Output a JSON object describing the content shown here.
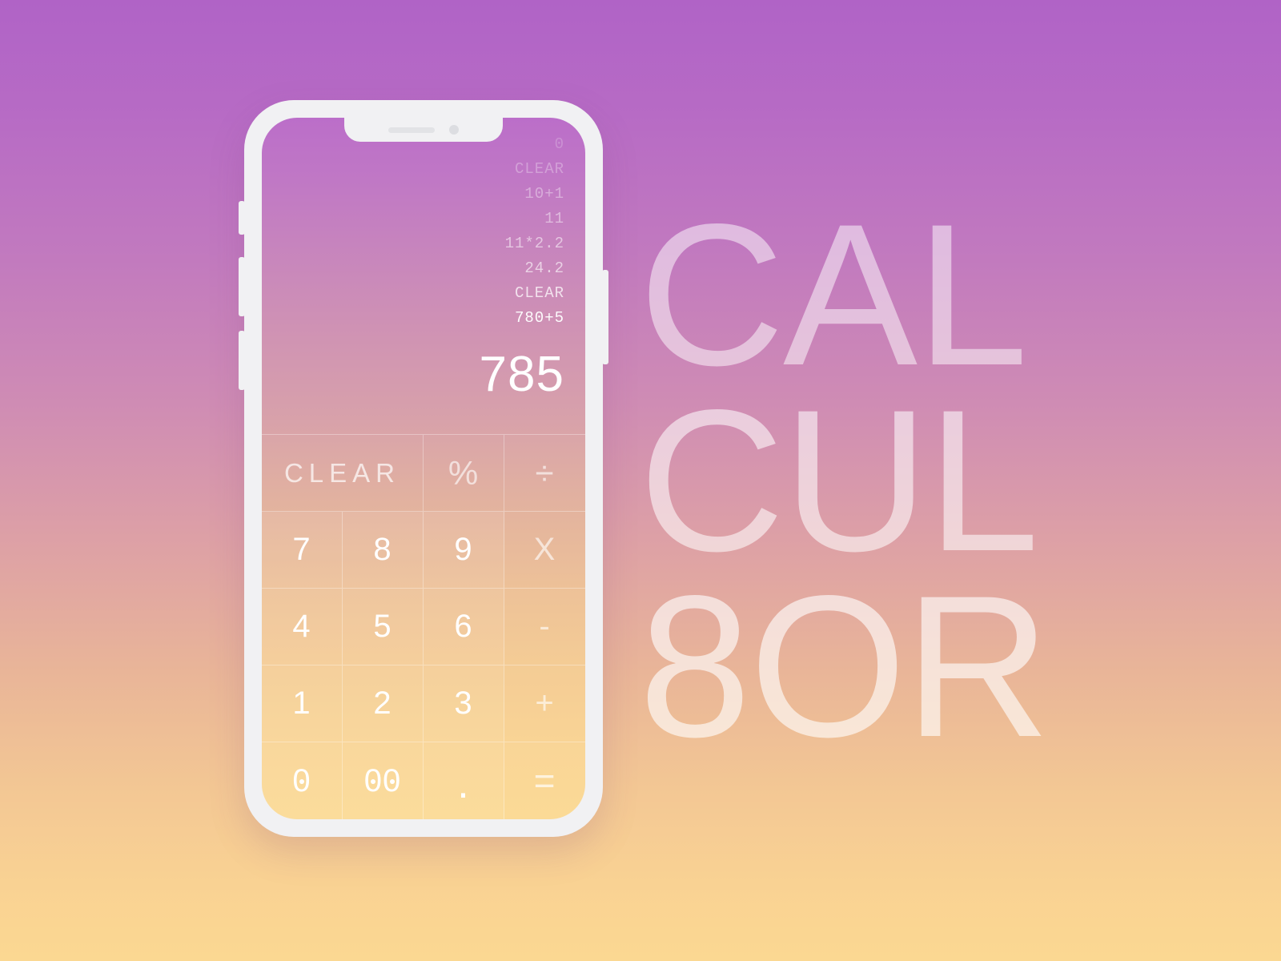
{
  "background": {
    "gradient_from": "#b063c6",
    "gradient_to": "#fbd892"
  },
  "wordmark": {
    "line1": "CAL",
    "line2": "CUL",
    "line3": "8OR",
    "color": "rgba(255,255,255,0.55)"
  },
  "phone": {
    "frame_color": "#f1f1f3",
    "buttons": {
      "silent": "silent-switch",
      "volume_up": "volume-up-button",
      "volume_down": "volume-down-button",
      "power": "power-button"
    },
    "notch": {
      "speaker": "speaker-slot",
      "camera": "front-camera"
    }
  },
  "calculator": {
    "history": [
      {
        "text": "0",
        "opacity": 0.22
      },
      {
        "text": "CLEAR",
        "opacity": 0.3
      },
      {
        "text": "10+1",
        "opacity": 0.38
      },
      {
        "text": "11",
        "opacity": 0.46
      },
      {
        "text": "11*2.2",
        "opacity": 0.54
      },
      {
        "text": "24.2",
        "opacity": 0.62
      },
      {
        "text": "CLEAR",
        "opacity": 0.74
      },
      {
        "text": "780+5",
        "opacity": 0.95
      }
    ],
    "current_expression": "780+5",
    "result": "785",
    "keys": {
      "clear": "CLEAR",
      "percent": "%",
      "divide": "÷",
      "seven": "7",
      "eight": "8",
      "nine": "9",
      "multiply": "X",
      "four": "4",
      "five": "5",
      "six": "6",
      "minus": "-",
      "one": "1",
      "two": "2",
      "three": "3",
      "plus": "+",
      "zero": "0",
      "double_zero": "00",
      "decimal": ".",
      "equals": "="
    }
  }
}
